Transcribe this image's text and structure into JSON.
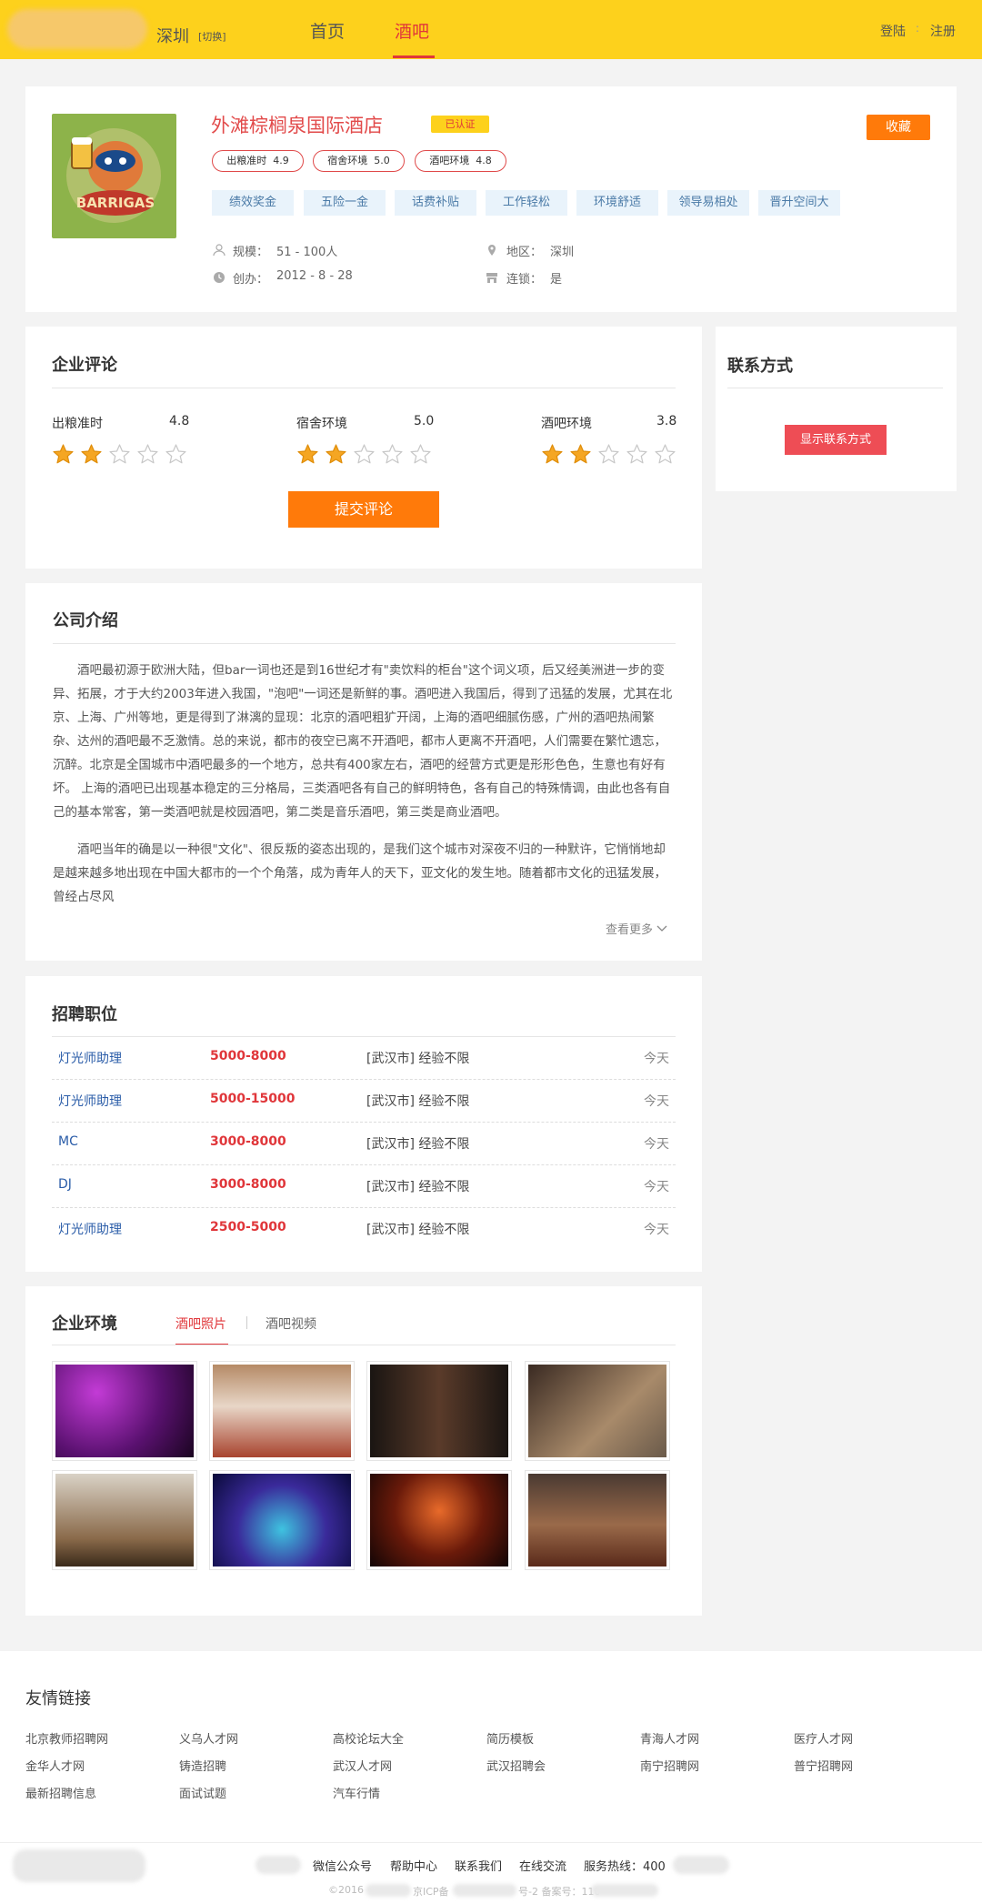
{
  "header": {
    "city": "深圳",
    "switch": "[切换]",
    "nav": [
      "首页",
      "酒吧"
    ],
    "login": "登陆",
    "sep": ":",
    "register": "注册"
  },
  "company": {
    "name": "外滩棕榈泉国际酒店",
    "verified": "已认证",
    "favorite": "收藏",
    "ratings": [
      {
        "label": "出粮准时",
        "value": "4.9"
      },
      {
        "label": "宿舍环境",
        "value": "5.0"
      },
      {
        "label": "酒吧环境",
        "value": "4.8"
      }
    ],
    "tags": [
      "绩效奖金",
      "五险一金",
      "话费补贴",
      "工作轻松",
      "环境舒适",
      "领导易相处",
      "晋升空间大"
    ],
    "scale_label": "规模：",
    "scale_value": "51 - 100人",
    "region_label": "地区：",
    "region_value": "深圳",
    "founded_label": "创办：",
    "founded_value": "2012 - 8 - 28",
    "chain_label": "连锁：",
    "chain_value": "是",
    "logo_text": "BARRIGAS"
  },
  "review": {
    "title": "企业评论",
    "items": [
      {
        "label": "出粮准时",
        "score": "4.8",
        "stars": 2
      },
      {
        "label": "宿舍环境",
        "score": "5.0",
        "stars": 2
      },
      {
        "label": "酒吧环境",
        "score": "3.8",
        "stars": 2
      }
    ],
    "submit": "提交评论"
  },
  "contact": {
    "title": "联系方式",
    "button": "显示联系方式"
  },
  "intro": {
    "title": "公司介绍",
    "p1": "酒吧最初源于欧洲大陆，但bar一词也还是到16世纪才有\"卖饮料的柜台\"这个词义项，后又经美洲进一步的变异、拓展，才于大约2003年进入我国，\"泡吧\"一词还是新鲜的事。酒吧进入我国后，得到了迅猛的发展，尤其在北京、上海、广州等地，更是得到了淋漓的显现：北京的酒吧粗犷开阔，上海的酒吧细腻伤感，广州的酒吧热闹繁杂、达州的酒吧最不乏激情。总的来说，都市的夜空已离不开酒吧，都市人更离不开酒吧，人们需要在繁忙遗忘，沉醉。北京是全国城市中酒吧最多的一个地方，总共有400家左右，酒吧的经营方式更是形形色色，生意也有好有坏。 上海的酒吧已出现基本稳定的三分格局，三类酒吧各有自己的鲜明特色，各有自己的特殊情调，由此也各有自己的基本常客，第一类酒吧就是校园酒吧，第二类是音乐酒吧，第三类是商业酒吧。",
    "p2": "酒吧当年的确是以一种很\"文化\"、很反叛的姿态出现的，是我们这个城市对深夜不归的一种默许，它悄悄地却是越来越多地出现在中国大都市的一个个角落，成为青年人的天下，亚文化的发生地。随着都市文化的迅猛发展，曾经占尽风",
    "more": "查看更多"
  },
  "jobs": {
    "title": "招聘职位",
    "rows": [
      {
        "name": "灯光师助理",
        "salary": "5000-8000",
        "info": "[武汉市]  经验不限",
        "date": "今天"
      },
      {
        "name": "灯光师助理",
        "salary": "5000-15000",
        "info": "[武汉市]  经验不限",
        "date": "今天"
      },
      {
        "name": "MC",
        "salary": "3000-8000",
        "info": "[武汉市]  经验不限",
        "date": "今天"
      },
      {
        "name": "DJ",
        "salary": "3000-8000",
        "info": "[武汉市]  经验不限",
        "date": "今天"
      },
      {
        "name": "灯光师助理",
        "salary": "2500-5000",
        "info": "[武汉市]  经验不限",
        "date": "今天"
      }
    ]
  },
  "env": {
    "title": "企业环境",
    "tabs": [
      "酒吧照片",
      "酒吧视频"
    ],
    "photos": [
      "band-stage",
      "dining-tables",
      "corridor",
      "bar-counter",
      "cafe-interior",
      "club-neon",
      "bar-lounge",
      "restaurant-hall"
    ]
  },
  "friends": {
    "title": "友情链接",
    "links": [
      "北京教师招聘网",
      "义乌人才网",
      "高校论坛大全",
      "简历模板",
      "青海人才网",
      "医疗人才网",
      "金华人才网",
      "铸造招聘",
      "武汉人才网",
      "武汉招聘会",
      "南宁招聘网",
      "普宁招聘网",
      "最新招聘信息",
      "面试试题",
      "汽车行情"
    ]
  },
  "footer": {
    "links": [
      "微信公众号",
      "帮助中心",
      "联系我们",
      "在线交流",
      "服务热线：400"
    ],
    "copyright_a": "©2016",
    "copyright_b": "京ICP备",
    "copyright_c": "号-2 备案号：110"
  },
  "colors": {
    "brand": "#fdd11c",
    "accent": "#e0363a",
    "orange": "#ff7a0a"
  }
}
